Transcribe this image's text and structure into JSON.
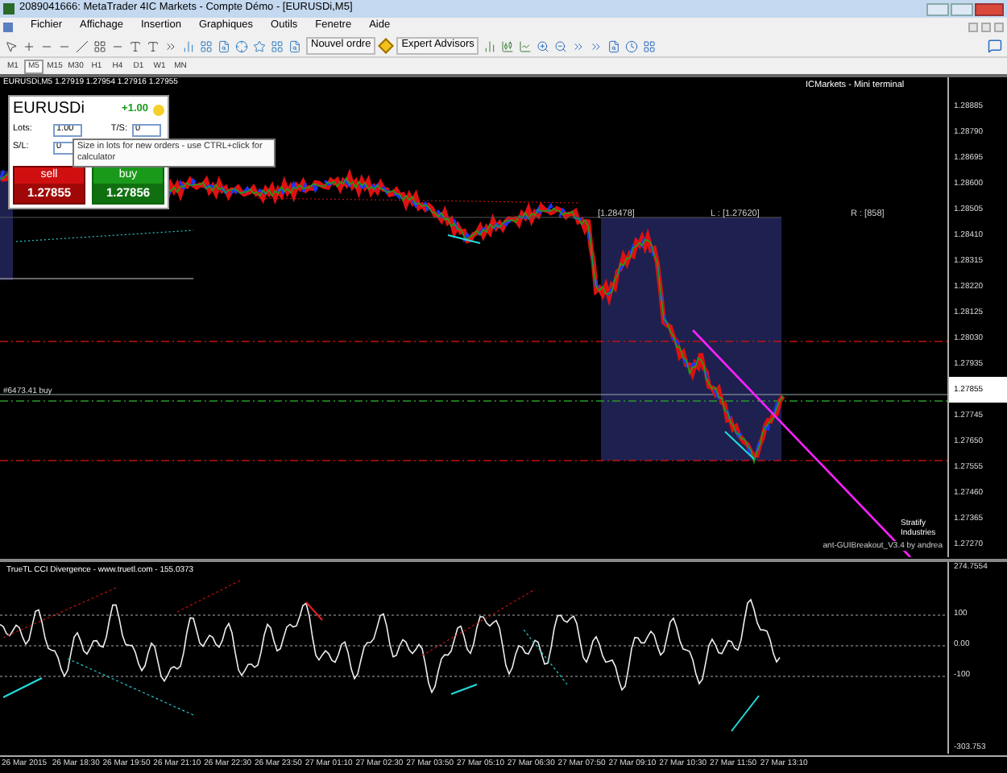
{
  "window": {
    "title": "2089041666: MetaTrader 4IC Markets - Compte Démo - [EURUSDi,M5]"
  },
  "menu": [
    "Fichier",
    "Affichage",
    "Insertion",
    "Graphiques",
    "Outils",
    "Fenetre",
    "Aide"
  ],
  "toolbar": {
    "buttons": [
      "Nouvel ordre",
      "Expert Advisors"
    ]
  },
  "timeframes": [
    {
      "label": "M1",
      "selected": false
    },
    {
      "label": "M5",
      "selected": true
    },
    {
      "label": "M15",
      "selected": false
    },
    {
      "label": "M30",
      "selected": false
    },
    {
      "label": "H1",
      "selected": false
    },
    {
      "label": "H4",
      "selected": false
    },
    {
      "label": "D1",
      "selected": false
    },
    {
      "label": "W1",
      "selected": false
    },
    {
      "label": "MN",
      "selected": false
    }
  ],
  "chart": {
    "header": "EURUSDi,M5  1.27919 1.27954 1.27916 1.27955",
    "broker_label": "ICMarkets - Mini terminal",
    "high_label": "[1.28478]",
    "low_label": "L : [1.27620]",
    "range_label": "R : [858]",
    "order_line_label": "#6473.41 buy",
    "ea_label": "ant-GUIBreakout_V3.4 by andrea",
    "logo_text": "Stratify Industries",
    "price_axis": [
      {
        "kind": "tick",
        "label": "1.28885"
      },
      {
        "kind": "tick",
        "label": "1.28790"
      },
      {
        "kind": "tick",
        "label": "1.28695"
      },
      {
        "kind": "tick",
        "label": "1.28600"
      },
      {
        "kind": "tick",
        "label": "1.28505"
      },
      {
        "kind": "tick",
        "label": "1.28410"
      },
      {
        "kind": "tick",
        "label": "1.28315"
      },
      {
        "kind": "tick",
        "label": "1.28220"
      },
      {
        "kind": "tick",
        "label": "1.28125"
      },
      {
        "kind": "tick",
        "label": "1.28030"
      },
      {
        "kind": "tick",
        "label": "1.27935"
      },
      {
        "kind": "current",
        "label": "1.27855"
      },
      {
        "kind": "tick",
        "label": "1.27745"
      },
      {
        "kind": "tick",
        "label": "1.27650"
      },
      {
        "kind": "tick",
        "label": "1.27555"
      },
      {
        "kind": "tick",
        "label": "1.27460"
      },
      {
        "kind": "tick",
        "label": "1.27365"
      },
      {
        "kind": "tick",
        "label": "1.27270"
      }
    ]
  },
  "mini_terminal": {
    "symbol": "EURUSDi",
    "change": "+1.00",
    "lots_label": "Lots:",
    "lots": "1.00",
    "ts_label": "T/S:",
    "ts": "0",
    "sl_label": "S/L:",
    "sl": "0",
    "tooltip": "Size in lots for new orders - use CTRL+click for calculator",
    "sell_label": "sell",
    "sell_price": "1.27855",
    "buy_label": "buy",
    "buy_price": "1.27856"
  },
  "indicator": {
    "title": "TrueTL CCI Divergence - www.truetl.com - 155.0373",
    "axis": [
      "274.7554",
      "100",
      "0.00",
      "-100",
      "-303.753"
    ]
  },
  "time_axis": [
    "26 Mar 2015",
    "26 Mar 18:30",
    "26 Mar 19:50",
    "26 Mar 21:10",
    "26 Mar 22:30",
    "26 Mar 23:50",
    "27 Mar 01:10",
    "27 Mar 02:30",
    "27 Mar 03:50",
    "27 Mar 05:10",
    "27 Mar 06:30",
    "27 Mar 07:50",
    "27 Mar 09:10",
    "27 Mar 10:30",
    "27 Mar 11:50",
    "27 Mar 13:10"
  ]
}
